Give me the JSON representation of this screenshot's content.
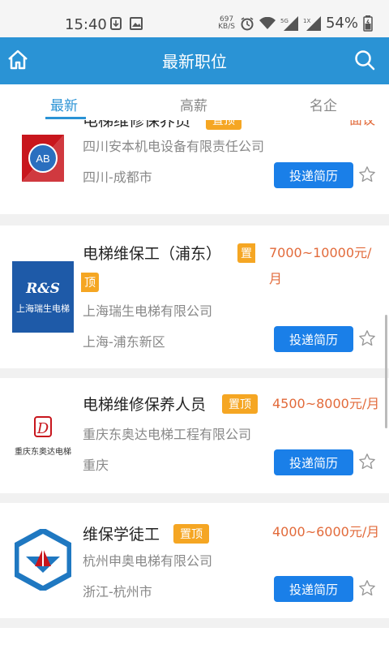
{
  "status": {
    "time": "15:40",
    "net_speed_value": "697",
    "net_speed_unit": "KB/S",
    "battery": "54%",
    "signal_5g": "5G",
    "signal_1x": "1X"
  },
  "header": {
    "title": "最新职位"
  },
  "tabs": [
    {
      "label": "最新"
    },
    {
      "label": "高薪"
    },
    {
      "label": "名企"
    }
  ],
  "jobs": [
    {
      "title": "电梯维修保养员",
      "pin": "置顶",
      "company": "四川安本机电设备有限责任公司",
      "location": "四川-成都市",
      "salary": "面议",
      "apply": "投递简历",
      "logo_text": "AB"
    },
    {
      "title": "电梯维保工（浦东）",
      "pin_top": "置",
      "pin_bottom": "顶",
      "company": "上海瑞生电梯有限公司",
      "location": "上海-浦东新区",
      "salary_line1": "7000~10000元/",
      "salary_line2": "月",
      "apply": "投递简历",
      "logo_text_top": "R&S",
      "logo_text_bottom": "上海瑞生电梯"
    },
    {
      "title": "电梯维修保养人员",
      "pin": "置顶",
      "company": "重庆东奥达电梯工程有限公司",
      "location": "重庆",
      "salary": "4500~8000元/月",
      "apply": "投递简历",
      "logo_text": "重庆东奥达电梯"
    },
    {
      "title": "维保学徒工",
      "pin": "置顶",
      "company": "杭州申奥电梯有限公司",
      "location": "浙江-杭州市",
      "salary": "4000~6000元/月",
      "apply": "投递简历"
    }
  ],
  "colors": {
    "brand": "#2a93d5",
    "apply": "#1a7fe8",
    "pin": "#f5a623",
    "salary": "#e26a3a"
  }
}
